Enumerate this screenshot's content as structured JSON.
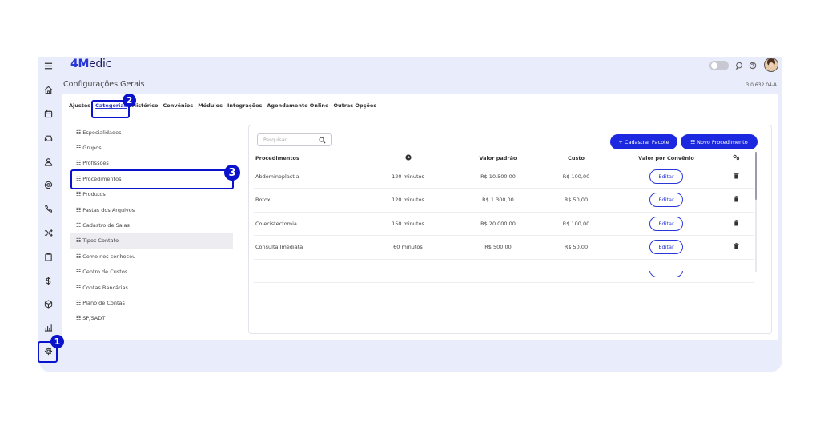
{
  "app": {
    "logo_part1": "4M",
    "logo_part2": "edic",
    "version": "3.0.632.04-A"
  },
  "page": {
    "title": "Configurações Gerais"
  },
  "tabs": [
    "Ajustes",
    "Categorias",
    "Histórico",
    "Convênios",
    "Módulos",
    "Integrações",
    "Agendamento Online",
    "Outras Opções"
  ],
  "active_tab": "Categorias",
  "categories": [
    "Especialidades",
    "Grupos",
    "Profissões",
    "Procedimentos",
    "Produtos",
    "Pastas dos Arquivos",
    "Cadastro de Salas",
    "Tipos Contato",
    "Como nos conheceu",
    "Centro de Custos",
    "Contas Bancárias",
    "Plano de Contas",
    "SP/SADT"
  ],
  "list_glyph": "☷",
  "search": {
    "placeholder": "Pesquisar"
  },
  "buttons": {
    "add_package": "+ Cadastrar Pacote",
    "new_procedure": "☷ Novo Procedimento"
  },
  "table": {
    "headers": {
      "name": "Procedimentos",
      "duration_icon": "clock-icon",
      "price": "Valor padrão",
      "cost": "Custo",
      "insurance": "Valor por Convênio",
      "settings_icon": "gears-icon"
    },
    "edit_label": "Editar",
    "rows": [
      {
        "name": "Abdominoplastia",
        "duration": "120 minutos",
        "price": "R$ 10.500,00",
        "cost": "R$ 100,00"
      },
      {
        "name": "Botox",
        "duration": "120 minutos",
        "price": "R$ 1.300,00",
        "cost": "R$ 50,00"
      },
      {
        "name": "Colecistectomia",
        "duration": "150 minutos",
        "price": "R$ 20.000,00",
        "cost": "R$ 100,00"
      },
      {
        "name": "Consulta Imediata",
        "duration": "60 minutos",
        "price": "R$ 500,00",
        "cost": "R$ 50,00"
      }
    ]
  },
  "annotations": {
    "step1": "1",
    "step2": "2",
    "step3": "3"
  },
  "colors": {
    "accent": "#2a37d8",
    "button": "#1b28e0",
    "annotation": "#0a12cc",
    "frame_bg": "#e9edfb"
  }
}
